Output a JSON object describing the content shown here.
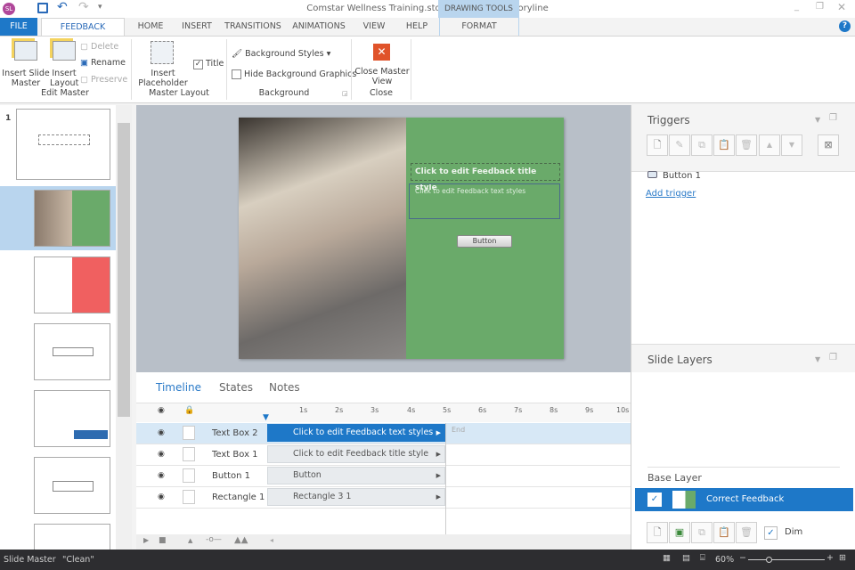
{
  "window": {
    "title": "Comstar Wellness Training.story* -  Articulate Storyline",
    "app_icon": "SL"
  },
  "tabs": [
    "FILE",
    "FEEDBACK MASTER",
    "HOME",
    "INSERT",
    "TRANSITIONS",
    "ANIMATIONS",
    "VIEW",
    "HELP"
  ],
  "contextual": {
    "group": "DRAWING TOOLS",
    "tab": "FORMAT"
  },
  "ribbon": {
    "edit_master": {
      "insert_slide_master": "Insert Slide Master",
      "insert_layout": "Insert Layout",
      "delete": "Delete",
      "rename": "Rename",
      "preserve": "Preserve",
      "label": "Edit Master"
    },
    "master_layout": {
      "insert_placeholder": "Insert Placeholder",
      "title": "Title",
      "title_checked": true,
      "label": "Master Layout"
    },
    "background": {
      "styles": "Background Styles",
      "hide_graphics": "Hide Background Graphics",
      "hide_checked": false,
      "label": "Background"
    },
    "close": {
      "close_master": "Close Master View",
      "label": "Close"
    }
  },
  "slides_panel": {
    "number": "1"
  },
  "slide": {
    "title_placeholder": "Click to edit Feedback title style",
    "text_placeholder": "Click to edit Feedback text styles",
    "button": "Button",
    "accent": "#6aaa6a"
  },
  "timeline": {
    "tabs": [
      "Timeline",
      "States",
      "Notes"
    ],
    "ruler": [
      "1s",
      "2s",
      "3s",
      "4s",
      "5s",
      "6s",
      "7s",
      "8s",
      "9s",
      "10s"
    ],
    "end_label": "End",
    "rows": [
      {
        "name": "Text Box 2",
        "bar": "Click to edit Feedback text styles",
        "selected": true
      },
      {
        "name": "Text Box 1",
        "bar": "Click to edit Feedback title style"
      },
      {
        "name": "Button 1",
        "bar": "Button"
      },
      {
        "name": "Rectangle 1",
        "bar": "Rectangle 3 1"
      }
    ]
  },
  "triggers": {
    "title": "Triggers",
    "item": "Button 1",
    "add": "Add trigger"
  },
  "layers": {
    "title": "Slide Layers",
    "base": "Base Layer",
    "layer": "Correct Feedback",
    "dim": "Dim",
    "dim_checked": true
  },
  "status": {
    "mode": "Slide Master",
    "theme": "\"Clean\"",
    "zoom": "60%"
  }
}
